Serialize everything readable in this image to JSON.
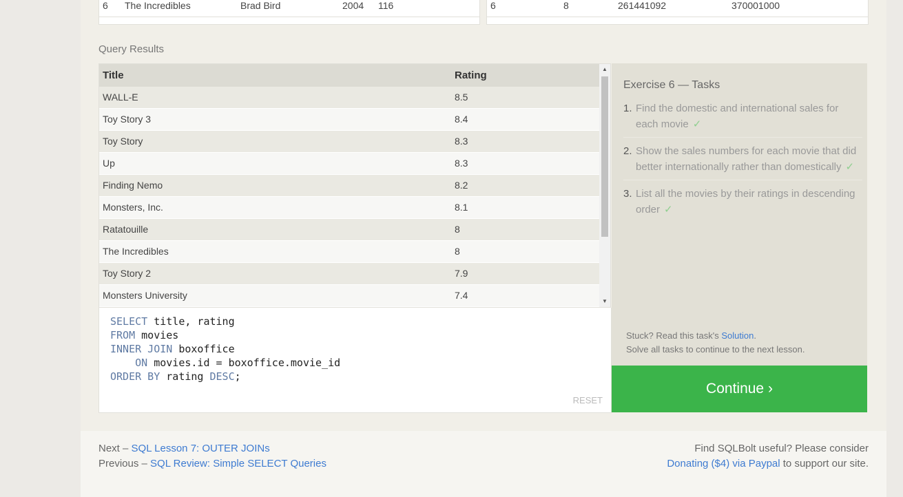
{
  "top_tables": {
    "movies_row": [
      "6",
      "The Incredibles",
      "Brad Bird",
      "2004",
      "116"
    ],
    "boxoffice_row": [
      "6",
      "8",
      "261441092",
      "370001000"
    ]
  },
  "query_results_label": "Query Results",
  "results": {
    "columns": [
      "Title",
      "Rating"
    ],
    "rows": [
      [
        "WALL-E",
        "8.5"
      ],
      [
        "Toy Story 3",
        "8.4"
      ],
      [
        "Toy Story",
        "8.3"
      ],
      [
        "Up",
        "8.3"
      ],
      [
        "Finding Nemo",
        "8.2"
      ],
      [
        "Monsters, Inc.",
        "8.1"
      ],
      [
        "Ratatouille",
        "8"
      ],
      [
        "The Incredibles",
        "8"
      ],
      [
        "Toy Story 2",
        "7.9"
      ],
      [
        "Monsters University",
        "7.4"
      ]
    ]
  },
  "editor": {
    "line1_kw": "SELECT",
    "line1_rest": " title, rating",
    "line2_kw": "FROM",
    "line2_rest": " movies",
    "line3_kw": "INNER JOIN",
    "line3_rest": " boxoffice",
    "line4_kw": "ON",
    "line4_rest": " movies.id = boxoffice.movie_id",
    "line5_kw": "ORDER BY",
    "line5_mid": " rating ",
    "line5_kw2": "DESC",
    "line5_end": ";",
    "reset_label": "RESET"
  },
  "tasks": {
    "title": "Exercise 6 — Tasks",
    "items": [
      {
        "num": "1.",
        "text": "Find the domestic and international sales for each movie",
        "check": "✓"
      },
      {
        "num": "2.",
        "text": "Show the sales numbers for each movie that did better internationally rather than domestically",
        "check": "✓"
      },
      {
        "num": "3.",
        "text": "List all the movies by their ratings in descending order",
        "check": "✓"
      }
    ],
    "stuck_prefix": "Stuck? Read this task's ",
    "solution_link": "Solution",
    "stuck_suffix": ".",
    "solve_all": "Solve all tasks to continue to the next lesson."
  },
  "continue_label": "Continue ›",
  "footer": {
    "next_prefix": "Next – ",
    "next_link": "SQL Lesson 7: OUTER JOINs",
    "prev_prefix": "Previous – ",
    "prev_link": "SQL Review: Simple SELECT Queries",
    "useful_text": "Find SQLBolt useful? Please consider",
    "donate_link": "Donating ($4) via Paypal",
    "donate_suffix": " to support our site."
  }
}
